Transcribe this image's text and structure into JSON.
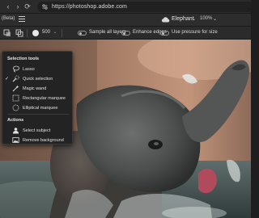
{
  "browser": {
    "url": "https://photoshop.adobe.com"
  },
  "header": {
    "beta_label": "(Beta)",
    "document_title": "Elephant",
    "zoom": "100%"
  },
  "options": {
    "brush_size": "500",
    "sample_all_layers": "Sample all layers",
    "enhance_edges": "Enhance edges",
    "use_pressure": "Use pressure for size"
  },
  "flyout": {
    "section_selection": "Selection tools",
    "items": [
      {
        "label": "Lasso",
        "icon": "lasso-icon",
        "checked": false
      },
      {
        "label": "Quick selection",
        "icon": "quick-selection-icon",
        "checked": true
      },
      {
        "label": "Magic wand",
        "icon": "magic-wand-icon",
        "checked": false
      },
      {
        "label": "Rectangular marquee",
        "icon": "rectangular-marquee-icon",
        "checked": false
      },
      {
        "label": "Elliptical marquee",
        "icon": "elliptical-marquee-icon",
        "checked": false
      }
    ],
    "section_actions": "Actions",
    "actions": [
      {
        "label": "Select subject",
        "icon": "select-subject-icon"
      },
      {
        "label": "Remove background",
        "icon": "remove-background-icon"
      }
    ],
    "check_mark": "✓"
  },
  "colors": {
    "chrome": "#2b2b2b",
    "panel": "#232323",
    "text": "#e6e6e6"
  }
}
